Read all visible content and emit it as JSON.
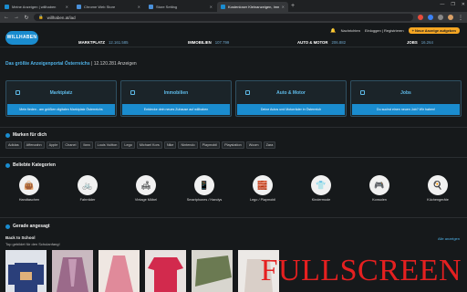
{
  "browser": {
    "tabs": [
      {
        "title": "Meine Anzeigen | willhaben",
        "active": false,
        "color": "#1a8ccf"
      },
      {
        "title": "Chrome Web Store",
        "active": false,
        "color": "#4a90d9"
      },
      {
        "title": "Store Setting",
        "active": false,
        "color": "#4a90d9"
      },
      {
        "title": "Kostenloser Kleinanzeigen, Imm",
        "active": true,
        "color": "#1a8ccf"
      }
    ],
    "new_tab": "+",
    "url": "willhaben.at/iad",
    "window_controls": [
      "—",
      "❐",
      "✕"
    ]
  },
  "header": {
    "logo": "WILLHABEN",
    "notifications": "Nachrichten",
    "login": "Einloggen | Registrieren",
    "post_button": "+ Neue Anzeige aufgeben",
    "categories": [
      {
        "label": "MARKTPLATZ",
        "count": "12.161.585"
      },
      {
        "label": "IMMOBILIEN",
        "count": "107.799"
      },
      {
        "label": "AUTO & MOTOR",
        "count": "206.882"
      },
      {
        "label": "JOBS",
        "count": "16.264"
      }
    ]
  },
  "hero": {
    "title": "Das größte Anzeigenportal Österreichs",
    "count": "| 12.120.281 Anzeigen",
    "tiles": [
      {
        "title": "Marktplatz",
        "cta": "Mein fieden - am größten digitalen Marktplatz Österreichs"
      },
      {
        "title": "Immobilien",
        "cta": "Entdecke dein neues Zuhause auf willhaben"
      },
      {
        "title": "Auto & Motor",
        "cta": "Deine Autos und Motorräder in Österreich"
      },
      {
        "title": "Jobs",
        "cta": "Du suchst einen neuen Job? Wir haben!"
      }
    ]
  },
  "brands": {
    "title": "Marken für dich",
    "items": [
      "Adidas",
      "Affenzahn",
      "Apple",
      "Chanel",
      "Ikea",
      "Louis Vuitton",
      "Lego",
      "Michael Kors",
      "Nike",
      "Nintendo",
      "Playmobil",
      "Playstation",
      "Woom",
      "Zara"
    ]
  },
  "popular": {
    "title": "Beliebte Kategorien",
    "items": [
      {
        "label": "Handtaschen",
        "icon": "👜"
      },
      {
        "label": "Fahrräder",
        "icon": "🚲"
      },
      {
        "label": "Vintage Möbel",
        "icon": "🛋"
      },
      {
        "label": "Smartphones / Handys",
        "icon": "📱"
      },
      {
        "label": "Lego / Playmobil",
        "icon": "🧱"
      },
      {
        "label": "Kindermode",
        "icon": "👕"
      },
      {
        "label": "Konsolen",
        "icon": "🎮"
      },
      {
        "label": "Küchengeräte",
        "icon": "🍳"
      }
    ]
  },
  "recent": {
    "title": "Gerade angesagt",
    "subtitle": "Back to School",
    "caption": "Top gebildet für den Schulanfang!",
    "all_link": "Alle anzeigen"
  },
  "overlay": {
    "text": "FULLSCREEN"
  }
}
